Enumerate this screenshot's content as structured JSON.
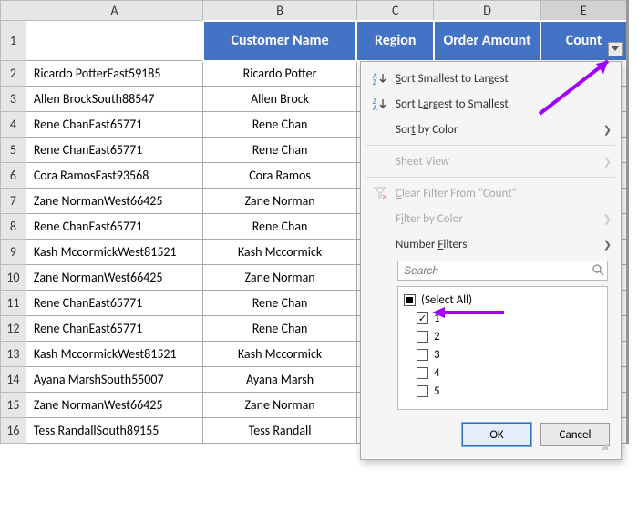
{
  "columns": {
    "A": "A",
    "B": "B",
    "C": "C",
    "D": "D",
    "E": "E"
  },
  "headers": {
    "b": "Customer Name",
    "c": "Region",
    "d": "Order Amount",
    "e": "Count"
  },
  "rows": [
    {
      "n": "2",
      "a": "Ricardo PotterEast59185",
      "b": "Ricardo Potter"
    },
    {
      "n": "3",
      "a": "Allen BrockSouth88547",
      "b": "Allen Brock"
    },
    {
      "n": "4",
      "a": "Rene ChanEast65771",
      "b": "Rene Chan"
    },
    {
      "n": "5",
      "a": "Rene ChanEast65771",
      "b": "Rene Chan"
    },
    {
      "n": "6",
      "a": "Cora RamosEast93568",
      "b": "Cora Ramos"
    },
    {
      "n": "7",
      "a": "Zane NormanWest66425",
      "b": "Zane Norman"
    },
    {
      "n": "8",
      "a": "Rene ChanEast65771",
      "b": "Rene Chan"
    },
    {
      "n": "9",
      "a": "Kash MccormickWest81521",
      "b": "Kash Mccormick"
    },
    {
      "n": "10",
      "a": "Zane NormanWest66425",
      "b": "Zane Norman"
    },
    {
      "n": "11",
      "a": "Rene ChanEast65771",
      "b": "Rene Chan"
    },
    {
      "n": "12",
      "a": "Rene ChanEast65771",
      "b": "Rene Chan"
    },
    {
      "n": "13",
      "a": "Kash MccormickWest81521",
      "b": "Kash Mccormick"
    },
    {
      "n": "14",
      "a": "Ayana MarshSouth55007",
      "b": "Ayana Marsh"
    },
    {
      "n": "15",
      "a": "Zane NormanWest66425",
      "b": "Zane Norman"
    },
    {
      "n": "16",
      "a": "Tess RandallSouth89155",
      "b": "Tess Randall"
    }
  ],
  "filter": {
    "sort_asc": "Sort Smallest to Largest",
    "sort_desc": "Sort Largest to Smallest",
    "sort_color_pre": "Sor",
    "sort_color_u": "t",
    "sort_color_post": " by Color",
    "sheet_view": "Sheet View",
    "clear_pre": "",
    "clear_u": "C",
    "clear_post": "lear Filter From \"Count\"",
    "filter_color_pre": "F",
    "filter_color_u": "i",
    "filter_color_post": "lter by Color",
    "number_pre": "Number ",
    "number_u": "F",
    "number_post": "ilters",
    "search_placeholder": "Search",
    "select_all": "(Select All)",
    "opts": [
      "1",
      "2",
      "3",
      "4",
      "5"
    ],
    "ok": "OK",
    "cancel": "Cancel"
  },
  "row1": "1"
}
